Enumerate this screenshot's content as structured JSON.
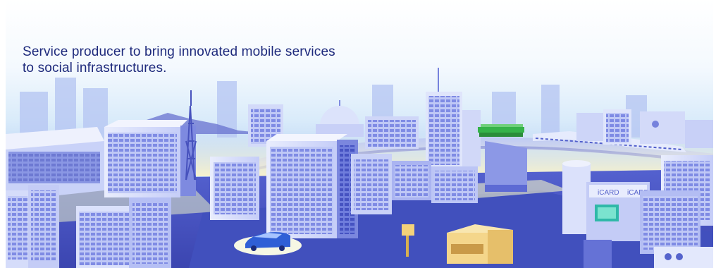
{
  "hero": {
    "tagline_lines": [
      "Service producer to bring innovated mobile services",
      "to social infrastructures."
    ],
    "sign_text": "iCARD",
    "sign_text_2": "iCARD"
  },
  "colors": {
    "sky_top": "#ffffff",
    "sky_mid": "#e4f1fb",
    "sky_bottom": "#a9c8f2",
    "ground": "#4a56c8",
    "road": "#3d47b3",
    "building_light": "#dfe5fb",
    "building_mid": "#9aa6ef",
    "building_dark": "#5562d2",
    "text": "#1e2a7c",
    "green_station": "#35b34a",
    "yellow_shop": "#f4d68b"
  }
}
